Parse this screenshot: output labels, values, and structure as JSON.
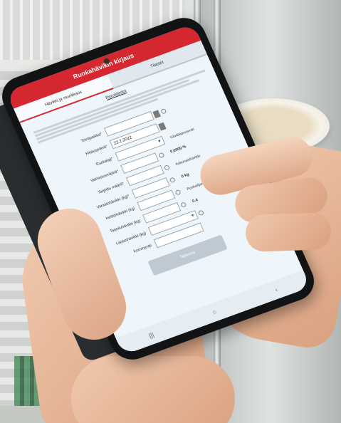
{
  "app": {
    "title": "Ruokahävikin kirjaus",
    "tabs": [
      {
        "label": "Hävikki ja muokkaus",
        "active": true
      },
      {
        "label": "Tilastot",
        "active": false
      }
    ],
    "section_heading": "Perustiedot"
  },
  "form": {
    "fields": [
      {
        "label": "Toimipaikka*",
        "value": ""
      },
      {
        "label": "Kirjauspäivä*",
        "value": "23.2.2022"
      },
      {
        "label": "Ruokalaji*",
        "value": ""
      },
      {
        "label": "Valmistusmäärä*",
        "value": ""
      },
      {
        "label": "Tarjoiltu määrä*",
        "value": ""
      },
      {
        "label": "Varastohävikki (kg)*",
        "value": ""
      },
      {
        "label": "Keittiöhävikki (kg)",
        "value": ""
      },
      {
        "label": "Tarjoiluhävikki (kg)",
        "value": ""
      },
      {
        "label": "Lautashävikki (kg)",
        "value": ""
      },
      {
        "label": "Kommentti",
        "value": ""
      }
    ],
    "side_values": [
      {
        "label": "Hävikkiprosentti",
        "value": "0.0000 %"
      },
      {
        "label": "Kokonaishävikki",
        "value": "0 kg"
      },
      {
        "label": "Ruokailijamäärä",
        "value": "0.4"
      }
    ],
    "save_label": "Tallenna"
  },
  "colors": {
    "app_bar": "#d5272f",
    "screen_bg": "#eef5fb",
    "save_button": "#bfc9d1"
  }
}
